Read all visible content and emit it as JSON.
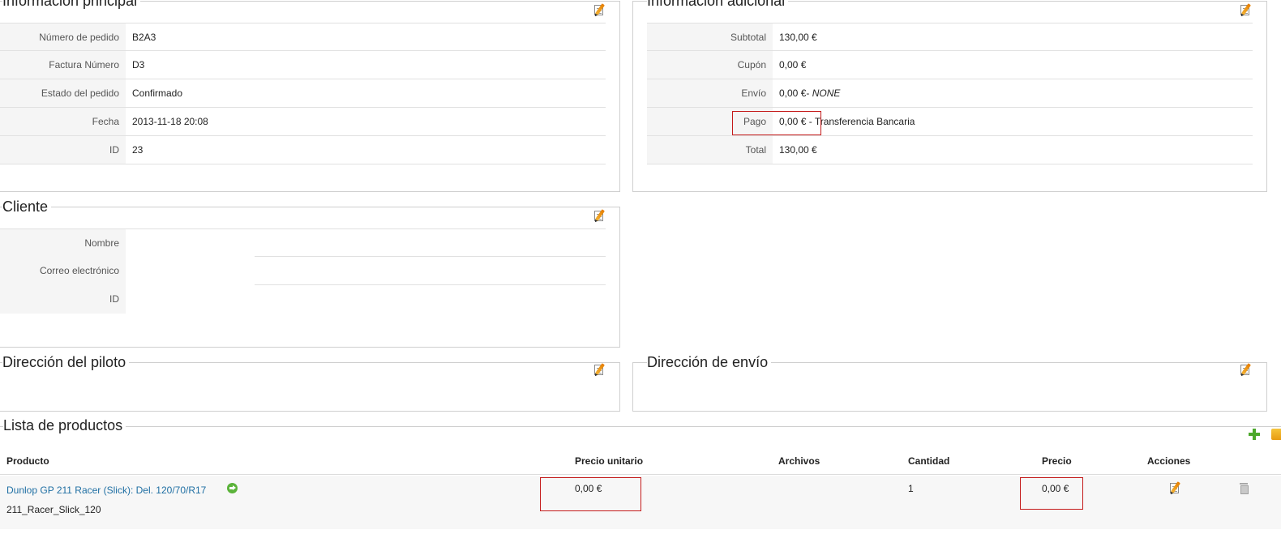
{
  "main_info": {
    "title": "Información principal",
    "rows": [
      {
        "label": "Número de pedido",
        "value": "B2A3"
      },
      {
        "label": "Factura Número",
        "value": "D3"
      },
      {
        "label": "Estado del pedido",
        "value": "Confirmado"
      },
      {
        "label": "Fecha",
        "value": "2013-11-18 20:08"
      },
      {
        "label": "ID",
        "value": "23"
      }
    ]
  },
  "additional_info": {
    "title": "Información adicional",
    "rows": [
      {
        "label": "Subtotal",
        "value": "130,00 €"
      },
      {
        "label": "Cupón",
        "value": "0,00 €"
      },
      {
        "label": "Envío",
        "value": "0,00 €",
        "suffix": "- ",
        "extra": "NONE"
      },
      {
        "label": "Pago",
        "value": "0,00 €",
        "suffix": " - Transferencia Bancaria"
      },
      {
        "label": "Total",
        "value": "130,00 €"
      }
    ]
  },
  "customer": {
    "title": "Cliente",
    "rows": [
      {
        "label": "Nombre",
        "value": ""
      },
      {
        "label": "Correo electrónico",
        "value": ""
      },
      {
        "label": "ID",
        "value": ""
      }
    ]
  },
  "pilot_address": {
    "title": "Dirección del piloto"
  },
  "shipping_address": {
    "title": "Dirección de envío"
  },
  "products": {
    "title": "Lista de productos",
    "headers": {
      "product": "Producto",
      "unit_price": "Precio unitario",
      "files": "Archivos",
      "quantity": "Cantidad",
      "price": "Precio",
      "actions": "Acciones"
    },
    "rows": [
      {
        "name": "Dunlop GP 211 Racer (Slick): Del. 120/70/R17",
        "code": "211_Racer_Slick_120",
        "unit_price": "0,00 €",
        "files": "",
        "quantity": "1",
        "price": "0,00 €"
      }
    ]
  },
  "icons": {
    "edit": "edit-icon",
    "goto": "arrow-right-circle-icon",
    "add": "plus-icon",
    "delete": "trash-icon"
  },
  "colors": {
    "link": "#1f6fa3",
    "highlight_box": "#c41a1a",
    "label_bg": "#f5f5f5"
  }
}
